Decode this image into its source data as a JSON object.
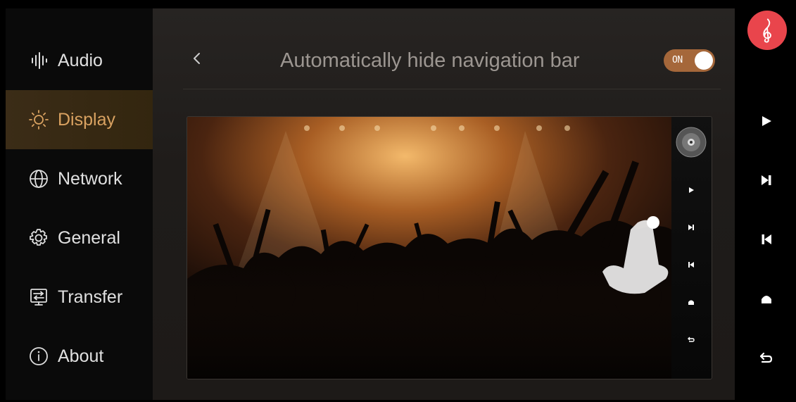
{
  "sidebar": {
    "items": [
      {
        "label": "Audio",
        "icon": "audio-bars-icon"
      },
      {
        "label": "Display",
        "icon": "sun-icon",
        "active": true
      },
      {
        "label": "Network",
        "icon": "globe-icon"
      },
      {
        "label": "General",
        "icon": "gear-icon"
      },
      {
        "label": "Transfer",
        "icon": "transfer-icon"
      },
      {
        "label": "About",
        "icon": "info-icon"
      }
    ]
  },
  "header": {
    "back_icon": "chevron-left-icon",
    "title": "Automatically hide navigation bar",
    "toggle": {
      "label": "ON",
      "state": true
    }
  },
  "preview": {
    "description_icons": [
      "disc-icon",
      "play-icon",
      "next-icon",
      "previous-icon",
      "home-icon",
      "back-icon"
    ]
  },
  "navbar": {
    "app_icon": "music-clef-icon",
    "buttons": [
      "play-icon",
      "next-icon",
      "previous-icon",
      "home-icon",
      "back-icon"
    ]
  },
  "colors": {
    "accent": "#d9a261",
    "toggle": "#a5673a",
    "app_button": "#e9454c",
    "active_bg": "#3b2c17"
  }
}
